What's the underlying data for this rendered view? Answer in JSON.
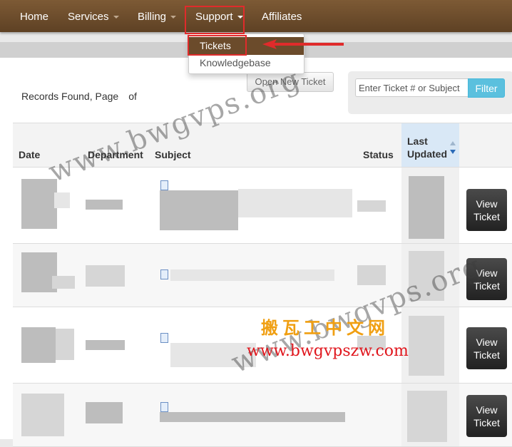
{
  "nav": {
    "home": "Home",
    "services": "Services",
    "billing": "Billing",
    "support": "Support",
    "affiliates": "Affiliates"
  },
  "support_menu": {
    "tickets": "Tickets",
    "knowledgebase": "Knowledgebase"
  },
  "records": {
    "prefix": "Records Found, Page",
    "of": "of"
  },
  "open_ticket_label": "Open New Ticket",
  "filter": {
    "placeholder": "Enter Ticket # or Subject",
    "button": "Filter"
  },
  "table": {
    "headers": [
      "Date",
      "Department",
      "Subject",
      "Status",
      "Last Updated"
    ]
  },
  "rows": [
    {
      "view": "View Ticket"
    },
    {
      "view": "View Ticket"
    },
    {
      "view": "View Ticket"
    },
    {
      "view": "View Ticket"
    }
  ],
  "watermark": {
    "domain": "www.bwgvps.org",
    "chinese": "搬瓦工中文网",
    "url": "www.bwgvpszw.com"
  },
  "colors": {
    "navbar": "#6b4b2b",
    "filter_button": "#5bc0de",
    "highlight": "#e02b2b",
    "view_button": "#333333"
  }
}
